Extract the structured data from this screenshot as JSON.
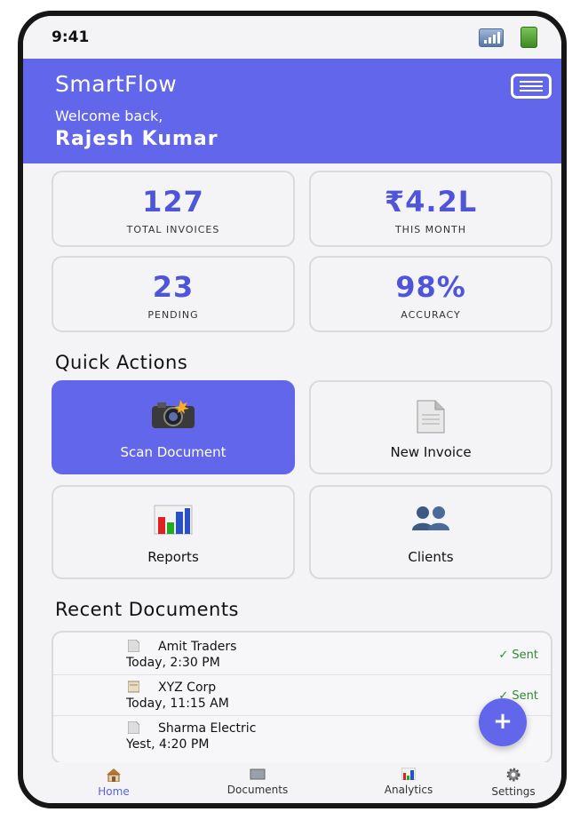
{
  "status_bar": {
    "time": "9:41"
  },
  "header": {
    "app_name": "SmartFlow",
    "welcome": "Welcome back,",
    "user_name": "Rajesh Kumar"
  },
  "stats": [
    {
      "value": "127",
      "label": "TOTAL INVOICES"
    },
    {
      "value": "₹4.2L",
      "label": "THIS MONTH"
    },
    {
      "value": "23",
      "label": "PENDING"
    },
    {
      "value": "98%",
      "label": "ACCURACY"
    }
  ],
  "quick_actions": {
    "title": "Quick Actions",
    "items": [
      {
        "label": "Scan Document",
        "icon": "camera-icon"
      },
      {
        "label": "New Invoice",
        "icon": "document-icon"
      },
      {
        "label": "Reports",
        "icon": "bar-chart-icon"
      },
      {
        "label": "Clients",
        "icon": "users-icon"
      }
    ]
  },
  "recent_documents": {
    "title": "Recent Documents",
    "items": [
      {
        "name": "Amit Traders",
        "time": "Today, 2:30 PM",
        "status": "✓ Sent",
        "icon": "document-icon"
      },
      {
        "name": "XYZ Corp",
        "time": "Today, 11:15 AM",
        "status": "✓ Sent",
        "icon": "folder-icon"
      },
      {
        "name": "Sharma Electric",
        "time": "Yest, 4:20 PM",
        "status": "",
        "icon": "document-icon"
      }
    ]
  },
  "fab": {
    "label": "+"
  },
  "tabs": [
    {
      "label": "Home",
      "icon": "home-icon",
      "active": true
    },
    {
      "label": "Documents",
      "icon": "folder-icon",
      "active": false
    },
    {
      "label": "Analytics",
      "icon": "bar-chart-icon",
      "active": false
    },
    {
      "label": "Settings",
      "icon": "gear-icon",
      "active": false
    }
  ],
  "colors": {
    "accent": "#6266ea",
    "stat_value": "#4f55d8",
    "sent": "#2e8b2e"
  }
}
